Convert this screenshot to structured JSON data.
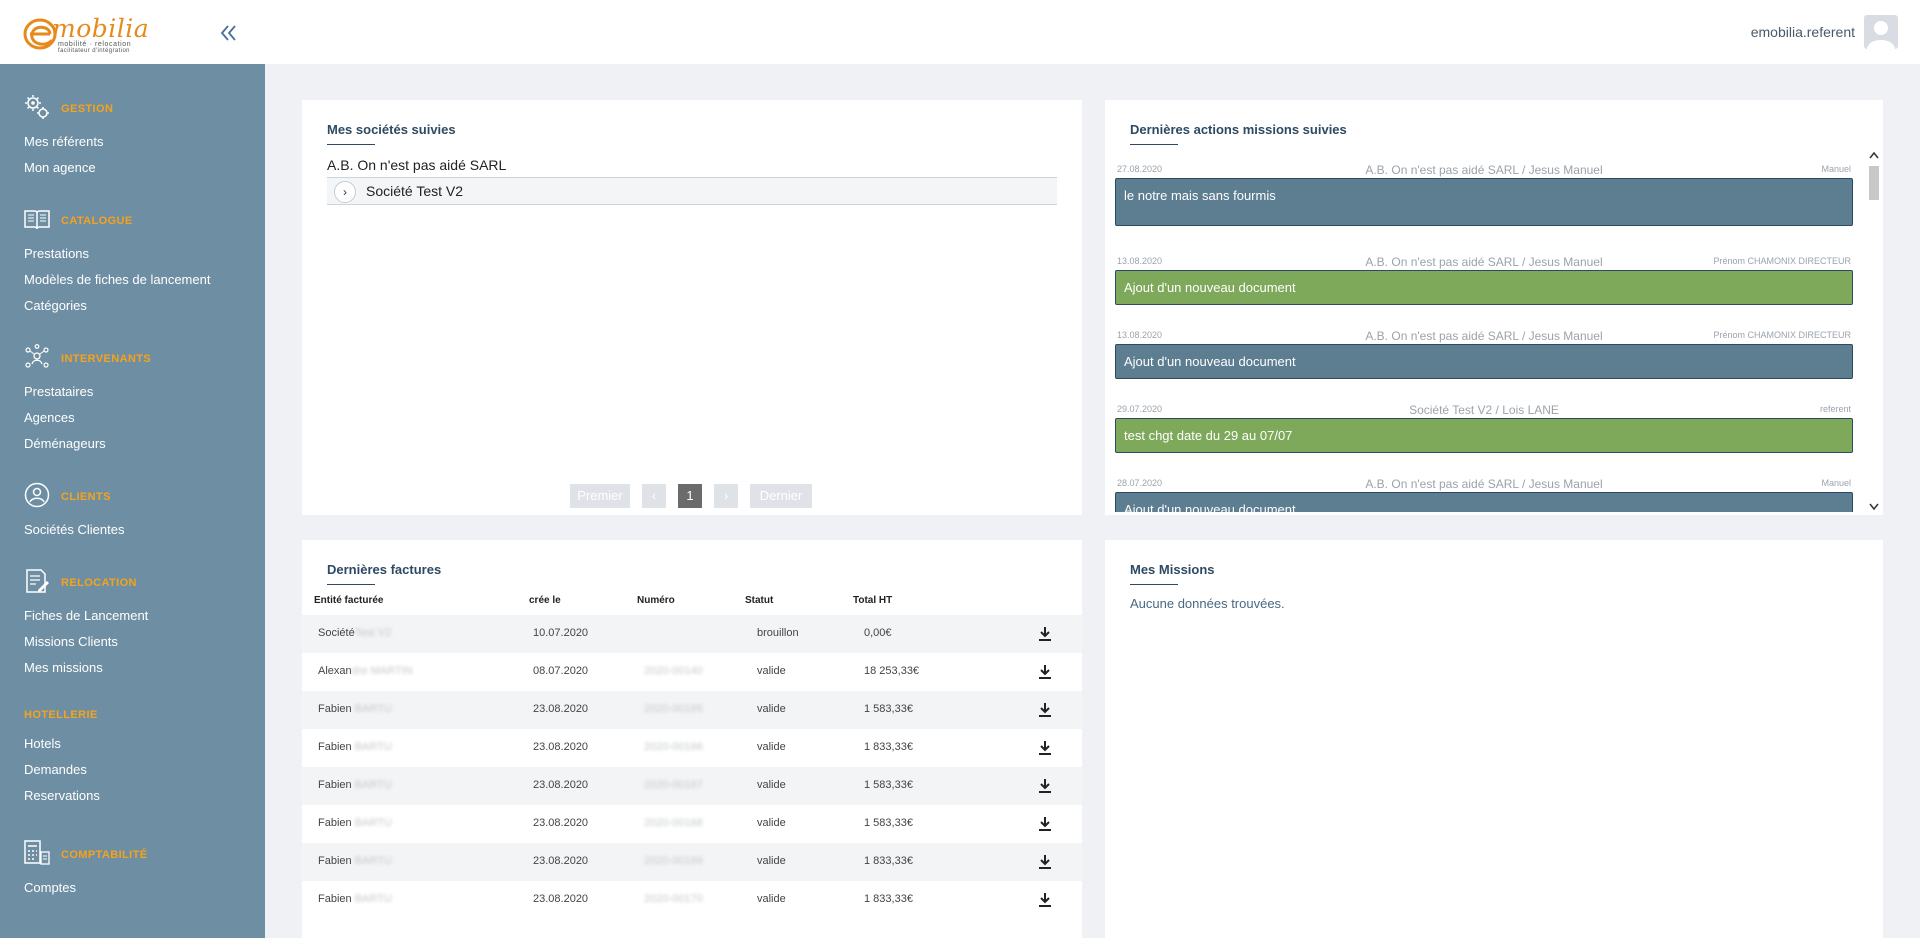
{
  "header": {
    "logo_text": "mobilia",
    "logo_tagline": "mobilité · relocation",
    "logo_tagline2": "facilitateur d'intégration",
    "user_name": "emobilia.referent"
  },
  "sidebar": {
    "sections": [
      {
        "title": "GESTION",
        "icon": "gears-icon",
        "items": [
          "Mes référents",
          "Mon agence"
        ]
      },
      {
        "title": "CATALOGUE",
        "icon": "book-icon",
        "items": [
          "Prestations",
          "Modèles de fiches de lancement",
          "Catégories"
        ]
      },
      {
        "title": "INTERVENANTS",
        "icon": "network-users-icon",
        "items": [
          "Prestataires",
          "Agences",
          "Déménageurs"
        ]
      },
      {
        "title": "CLIENTS",
        "icon": "user-circle-icon",
        "items": [
          "Sociétés Clientes"
        ]
      },
      {
        "title": "RELOCATION",
        "icon": "document-edit-icon",
        "items": [
          "Fiches de Lancement",
          "Missions Clients",
          "Mes missions"
        ]
      },
      {
        "title": "HOTELLERIE",
        "icon": "",
        "items": [
          "Hotels",
          "Demandes",
          "Reservations"
        ]
      },
      {
        "title": "COMPTABILITÉ",
        "icon": "calculator-icon",
        "items": [
          "Comptes"
        ]
      }
    ]
  },
  "societes": {
    "title": "Mes sociétés suivies",
    "root": "A.B. On n'est pas aidé SARL",
    "child": "Société Test V2",
    "pager": {
      "first": "Premier",
      "prev": "‹",
      "page": "1",
      "next": "›",
      "last": "Dernier"
    }
  },
  "actions": {
    "title": "Dernières actions missions suivies",
    "items": [
      {
        "date": "27.08.2020",
        "who": "A.B. On n'est pas aidé SARL / Jesus Manuel",
        "author": "Manuel",
        "text": "le notre mais sans fourmis",
        "color": "blue"
      },
      {
        "date": "13.08.2020",
        "who": "A.B. On n'est pas aidé SARL / Jesus Manuel",
        "author": "Prénom CHAMONIX DIRECTEUR",
        "text": "Ajout d'un nouveau document",
        "color": "green"
      },
      {
        "date": "13.08.2020",
        "who": "A.B. On n'est pas aidé SARL / Jesus Manuel",
        "author": "Prénom CHAMONIX DIRECTEUR",
        "text": "Ajout d'un nouveau document",
        "color": "blue"
      },
      {
        "date": "29.07.2020",
        "who": "Société Test V2 / Lois LANE",
        "author": "referent",
        "text": "test chgt date du 29 au 07/07",
        "color": "green"
      },
      {
        "date": "28.07.2020",
        "who": "A.B. On n'est pas aidé SARL / Jesus Manuel",
        "author": "Manuel",
        "text": "Ajout d'un nouveau document",
        "color": "blue"
      }
    ]
  },
  "factures": {
    "title": "Dernières factures",
    "columns": [
      "Entité facturée",
      "crée le",
      "Numéro",
      "Statut",
      "Total HT"
    ],
    "rows": [
      {
        "entity": "Société",
        "entity_hidden": "Test V2",
        "date": "10.07.2020",
        "number": "",
        "status": "brouillon",
        "total": "0,00€"
      },
      {
        "entity": "Alexan",
        "entity_hidden": "dre MARTIN",
        "date": "08.07.2020",
        "number": "2020-00140",
        "status": "valide",
        "total": "18 253,33€"
      },
      {
        "entity": "Fabien",
        "entity_hidden": "BARTU",
        "date": "23.08.2020",
        "number": "2020-00165",
        "status": "valide",
        "total": "1 583,33€"
      },
      {
        "entity": "Fabien",
        "entity_hidden": "BARTU",
        "date": "23.08.2020",
        "number": "2020-00166",
        "status": "valide",
        "total": "1 833,33€"
      },
      {
        "entity": "Fabien",
        "entity_hidden": "BARTU",
        "date": "23.08.2020",
        "number": "2020-00167",
        "status": "valide",
        "total": "1 583,33€"
      },
      {
        "entity": "Fabien",
        "entity_hidden": "BARTU",
        "date": "23.08.2020",
        "number": "2020-00168",
        "status": "valide",
        "total": "1 583,33€"
      },
      {
        "entity": "Fabien",
        "entity_hidden": "BARTU",
        "date": "23.08.2020",
        "number": "2020-00169",
        "status": "valide",
        "total": "1 833,33€"
      },
      {
        "entity": "Fabien",
        "entity_hidden": "BARTU",
        "date": "23.08.2020",
        "number": "2020-00170",
        "status": "valide",
        "total": "1 833,33€"
      }
    ]
  },
  "missions": {
    "title": "Mes Missions",
    "empty": "Aucune données trouvées."
  },
  "colors": {
    "accent": "#f7a21b",
    "sidebar": "#6e8fa3",
    "action_blue": "#5d7d91",
    "action_green": "#7ea85a"
  }
}
